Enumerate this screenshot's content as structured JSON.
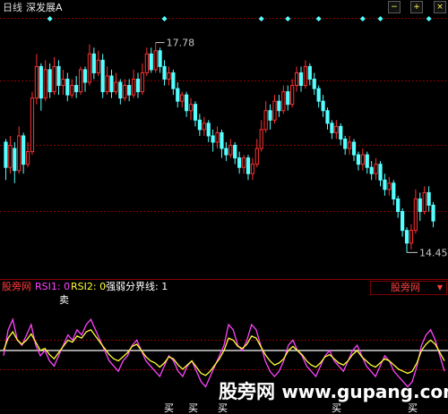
{
  "header": {
    "period": "日线",
    "stock_name": "深发展A",
    "buttons": {
      "minus": "−",
      "plus": "+",
      "close": "×"
    }
  },
  "price_chart": {
    "high_label": "17.78",
    "low_label": "14.45",
    "up_color": "#ff3030",
    "down_color": "#55ffff",
    "gridline_color": "#8a0000",
    "signal_color": "#55ffff"
  },
  "indicator": {
    "name": "股旁网",
    "rsi1_label": "RSI1: 0",
    "rsi2_label": "RSI2: 0",
    "split_label": "强弱分界线: 1",
    "selector": "股旁网",
    "selector_arrow": "▼",
    "sell_mark": "卖",
    "buy_marks": [
      "买",
      "买",
      "买",
      "买",
      "买"
    ],
    "rsi1_color": "#ff44ff",
    "rsi2_color": "#ffff33",
    "split_color": "#ffffff"
  },
  "watermark": {
    "text": "股旁网",
    "url": "www.gupang.com"
  },
  "chart_data": {
    "type": "candlestick",
    "panels": [
      {
        "name": "price",
        "ylim": [
          14.2,
          18.2
        ],
        "candles": [
          [
            16.2,
            15.8,
            16.25,
            15.6
          ],
          [
            15.8,
            16.15,
            16.3,
            15.7
          ],
          [
            16.1,
            15.75,
            16.2,
            15.55
          ],
          [
            15.75,
            16.3,
            16.45,
            15.7
          ],
          [
            16.3,
            15.85,
            16.35,
            15.7
          ],
          [
            15.85,
            16.05,
            16.2,
            15.8
          ],
          [
            16.05,
            16.9,
            17.0,
            16.0
          ],
          [
            16.9,
            17.4,
            17.6,
            16.8
          ],
          [
            17.4,
            16.9,
            17.45,
            16.7
          ],
          [
            16.9,
            17.35,
            17.5,
            16.85
          ],
          [
            17.35,
            17.0,
            17.45,
            16.9
          ],
          [
            17.0,
            17.4,
            17.55,
            16.95
          ],
          [
            17.4,
            17.1,
            17.5,
            16.95
          ],
          [
            17.1,
            17.2,
            17.35,
            16.95
          ],
          [
            17.2,
            16.95,
            17.3,
            16.85
          ],
          [
            16.95,
            17.1,
            17.2,
            16.9
          ],
          [
            17.1,
            17.0,
            17.25,
            16.9
          ],
          [
            17.0,
            17.35,
            17.4,
            16.95
          ],
          [
            17.35,
            17.15,
            17.4,
            17.0
          ],
          [
            17.15,
            17.6,
            17.75,
            17.1
          ],
          [
            17.6,
            17.3,
            17.7,
            17.2
          ],
          [
            17.3,
            17.5,
            17.65,
            17.25
          ],
          [
            17.5,
            17.0,
            17.6,
            16.9
          ],
          [
            17.0,
            17.25,
            17.4,
            16.95
          ],
          [
            17.25,
            17.0,
            17.35,
            16.9
          ],
          [
            17.0,
            17.15,
            17.3,
            16.95
          ],
          [
            17.15,
            16.9,
            17.2,
            16.8
          ],
          [
            16.9,
            17.1,
            17.2,
            16.85
          ],
          [
            17.1,
            16.95,
            17.2,
            16.85
          ],
          [
            16.95,
            17.2,
            17.35,
            16.9
          ],
          [
            17.2,
            17.0,
            17.3,
            16.9
          ],
          [
            17.0,
            17.3,
            17.45,
            16.95
          ],
          [
            17.3,
            17.6,
            17.7,
            17.25
          ],
          [
            17.6,
            17.35,
            17.7,
            17.3
          ],
          [
            17.35,
            17.65,
            17.78,
            17.3
          ],
          [
            17.65,
            17.4,
            17.7,
            17.3
          ],
          [
            17.4,
            17.2,
            17.5,
            17.1
          ],
          [
            17.2,
            17.3,
            17.4,
            17.1
          ],
          [
            17.3,
            17.05,
            17.35,
            16.95
          ],
          [
            17.05,
            16.85,
            17.15,
            16.75
          ],
          [
            16.85,
            16.95,
            17.0,
            16.75
          ],
          [
            16.95,
            16.7,
            17.0,
            16.6
          ],
          [
            16.7,
            16.8,
            16.9,
            16.55
          ],
          [
            16.8,
            16.55,
            16.85,
            16.45
          ],
          [
            16.55,
            16.4,
            16.65,
            16.3
          ],
          [
            16.4,
            16.5,
            16.6,
            16.3
          ],
          [
            16.5,
            16.3,
            16.55,
            16.2
          ],
          [
            16.3,
            16.2,
            16.4,
            16.05
          ],
          [
            16.2,
            16.35,
            16.45,
            16.1
          ],
          [
            16.35,
            16.1,
            16.4,
            15.95
          ],
          [
            16.1,
            16.0,
            16.2,
            15.9
          ],
          [
            16.0,
            16.15,
            16.25,
            15.95
          ],
          [
            16.15,
            15.95,
            16.2,
            15.85
          ],
          [
            15.95,
            15.8,
            16.05,
            15.7
          ],
          [
            15.8,
            15.95,
            16.0,
            15.7
          ],
          [
            15.95,
            15.7,
            16.0,
            15.6
          ],
          [
            15.7,
            15.85,
            15.95,
            15.6
          ],
          [
            15.85,
            16.1,
            16.25,
            15.8
          ],
          [
            16.1,
            16.4,
            16.55,
            16.05
          ],
          [
            16.4,
            16.7,
            16.85,
            16.35
          ],
          [
            16.7,
            16.55,
            16.8,
            16.4
          ],
          [
            16.55,
            16.85,
            16.95,
            16.5
          ],
          [
            16.85,
            16.7,
            16.95,
            16.6
          ],
          [
            16.7,
            17.0,
            17.1,
            16.65
          ],
          [
            17.0,
            16.8,
            17.1,
            16.7
          ],
          [
            16.8,
            17.1,
            17.2,
            16.75
          ],
          [
            17.1,
            17.3,
            17.4,
            17.0
          ],
          [
            17.3,
            17.1,
            17.4,
            17.0
          ],
          [
            17.1,
            17.4,
            17.5,
            17.05
          ],
          [
            17.4,
            17.2,
            17.45,
            17.1
          ],
          [
            17.2,
            17.05,
            17.3,
            16.95
          ],
          [
            17.05,
            16.85,
            17.1,
            16.75
          ],
          [
            16.85,
            16.7,
            16.95,
            16.6
          ],
          [
            16.7,
            16.5,
            16.75,
            16.4
          ],
          [
            16.5,
            16.35,
            16.55,
            16.25
          ],
          [
            16.35,
            16.45,
            16.55,
            16.25
          ],
          [
            16.45,
            16.25,
            16.5,
            16.15
          ],
          [
            16.25,
            16.1,
            16.3,
            16.0
          ],
          [
            16.1,
            16.2,
            16.3,
            16.0
          ],
          [
            16.2,
            16.0,
            16.25,
            15.9
          ],
          [
            16.0,
            15.85,
            16.05,
            15.75
          ],
          [
            15.85,
            16.0,
            16.1,
            15.75
          ],
          [
            16.0,
            15.8,
            16.05,
            15.7
          ],
          [
            15.8,
            15.7,
            15.9,
            15.6
          ],
          [
            15.7,
            15.85,
            15.95,
            15.6
          ],
          [
            15.85,
            15.6,
            15.9,
            15.5
          ],
          [
            15.6,
            15.45,
            15.7,
            15.35
          ],
          [
            15.45,
            15.55,
            15.65,
            15.35
          ],
          [
            15.55,
            15.3,
            15.6,
            15.2
          ],
          [
            15.3,
            15.1,
            15.35,
            15.0
          ],
          [
            15.1,
            14.8,
            15.15,
            14.7
          ],
          [
            14.8,
            14.6,
            14.85,
            14.45
          ],
          [
            14.6,
            14.8,
            14.9,
            14.5
          ],
          [
            14.8,
            15.3,
            15.45,
            14.75
          ],
          [
            15.3,
            15.1,
            15.4,
            14.95
          ],
          [
            15.1,
            15.4,
            15.5,
            15.05
          ],
          [
            15.4,
            15.2,
            15.5,
            15.1
          ],
          [
            15.2,
            14.95,
            15.25,
            14.85
          ]
        ]
      },
      {
        "name": "indicator",
        "ylim": [
          0,
          100
        ],
        "series": [
          {
            "name": "RSI1",
            "values": [
              45,
              70,
              80,
              60,
              55,
              65,
              75,
              55,
              45,
              50,
              40,
              35,
              45,
              55,
              65,
              60,
              70,
              65,
              75,
              80,
              70,
              60,
              50,
              40,
              35,
              30,
              40,
              45,
              55,
              60,
              50,
              40,
              35,
              30,
              25,
              35,
              45,
              40,
              30,
              25,
              35,
              40,
              30,
              20,
              15,
              25,
              35,
              45,
              55,
              75,
              70,
              55,
              50,
              60,
              75,
              70,
              55,
              40,
              30,
              25,
              30,
              40,
              55,
              60,
              50,
              45,
              35,
              30,
              25,
              35,
              45,
              50,
              40,
              35,
              30,
              40,
              50,
              55,
              45,
              35,
              30,
              25,
              35,
              45,
              40,
              30,
              25,
              20,
              15,
              20,
              35,
              55,
              65,
              70,
              60,
              45,
              30
            ]
          },
          {
            "name": "RSI2",
            "values": [
              50,
              62,
              68,
              60,
              56,
              60,
              66,
              58,
              50,
              52,
              46,
              42,
              48,
              54,
              60,
              58,
              64,
              62,
              68,
              70,
              64,
              58,
              52,
              46,
              42,
              40,
              44,
              48,
              54,
              56,
              50,
              44,
              40,
              38,
              34,
              38,
              44,
              42,
              36,
              32,
              36,
              40,
              34,
              28,
              26,
              30,
              36,
              42,
              50,
              62,
              60,
              54,
              52,
              56,
              64,
              62,
              54,
              46,
              40,
              36,
              38,
              42,
              50,
              54,
              50,
              46,
              40,
              36,
              34,
              38,
              44,
              46,
              42,
              38,
              36,
              40,
              46,
              50,
              44,
              40,
              36,
              34,
              38,
              42,
              40,
              36,
              32,
              30,
              28,
              30,
              38,
              50,
              56,
              60,
              56,
              48,
              40
            ]
          }
        ],
        "split_value": 50
      }
    ]
  }
}
